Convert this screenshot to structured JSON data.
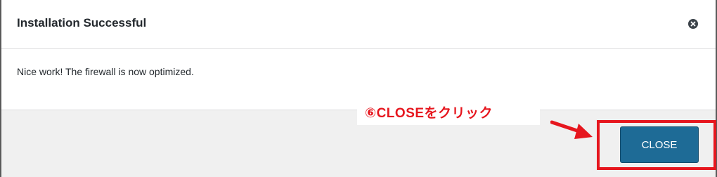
{
  "dialog": {
    "title": "Installation Successful",
    "message": "Nice work! The firewall is now optimized.",
    "close_button_label": "CLOSE"
  },
  "annotation": {
    "step_text": "⑥CLOSEをクリック",
    "color": "#e6161e"
  },
  "colors": {
    "primary_button": "#1e6b96",
    "footer_background": "#f0f0f0"
  }
}
